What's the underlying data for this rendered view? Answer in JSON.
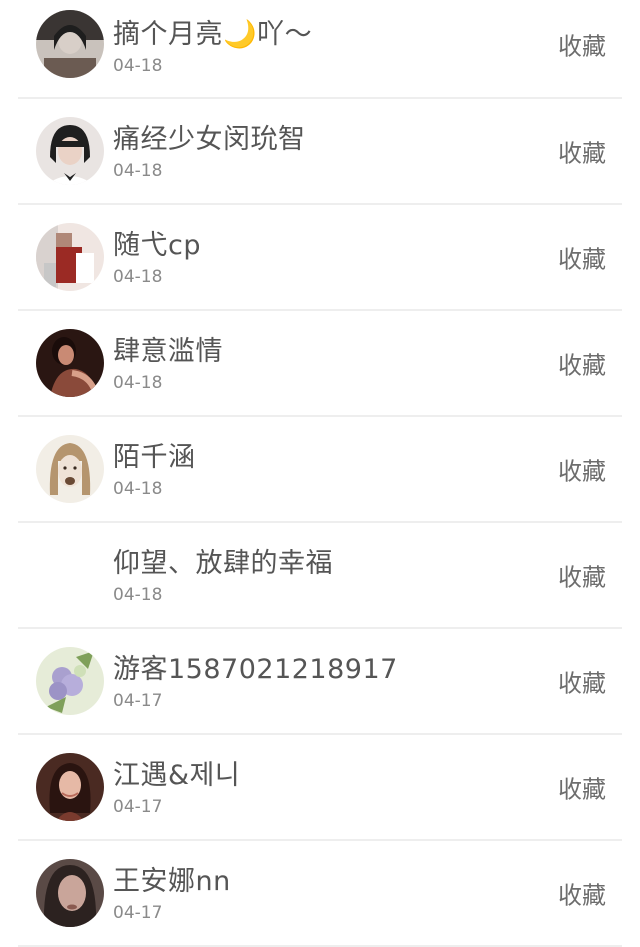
{
  "follow_list": {
    "items": [
      {
        "name": "摘个月亮🌙吖～",
        "date": "04-18",
        "action_label": "收藏",
        "avatar": "avatar-girl-dark-hair",
        "avatar_colors": [
          "#2b2b2b",
          "#c9c2bc",
          "#6b5b52"
        ]
      },
      {
        "name": "痛经少女闵玧智",
        "date": "04-18",
        "action_label": "收藏",
        "avatar": "avatar-girl-bob-hair",
        "avatar_colors": [
          "#e9e4e2",
          "#1f1f1f",
          "#d8b8a8"
        ]
      },
      {
        "name": "随弋cp",
        "date": "04-18",
        "action_label": "收藏",
        "avatar": "avatar-red-jacket",
        "avatar_colors": [
          "#f0e6e2",
          "#9b2a24",
          "#d9d2cf"
        ]
      },
      {
        "name": "肆意滥情",
        "date": "04-18",
        "action_label": "收藏",
        "avatar": "avatar-dark-portrait",
        "avatar_colors": [
          "#2a1612",
          "#8a4a3a",
          "#c98a74"
        ]
      },
      {
        "name": "陌千涵",
        "date": "04-18",
        "action_label": "收藏",
        "avatar": "avatar-light-portrait",
        "avatar_colors": [
          "#f2eee6",
          "#b5956e",
          "#6a4a35"
        ]
      },
      {
        "name": "仰望、放肆的幸福",
        "date": "04-18",
        "action_label": "收藏",
        "avatar": "",
        "avatar_colors": []
      },
      {
        "name": "游客15870212189​17",
        "date": "04-17",
        "action_label": "收藏",
        "avatar": "avatar-flower-bouquet",
        "avatar_colors": [
          "#e6ecd8",
          "#a9a0cf",
          "#7fa05a"
        ]
      },
      {
        "name": "江遇&제니",
        "date": "04-17",
        "action_label": "收藏",
        "avatar": "avatar-girl-portrait",
        "avatar_colors": [
          "#4a2a22",
          "#e6b9a6",
          "#7a3b2e"
        ]
      },
      {
        "name": "王安娜nn",
        "date": "04-17",
        "action_label": "收藏",
        "avatar": "avatar-blurred-face",
        "avatar_colors": [
          "#5a4a46",
          "#c9a59a",
          "#2c2220"
        ]
      }
    ]
  }
}
